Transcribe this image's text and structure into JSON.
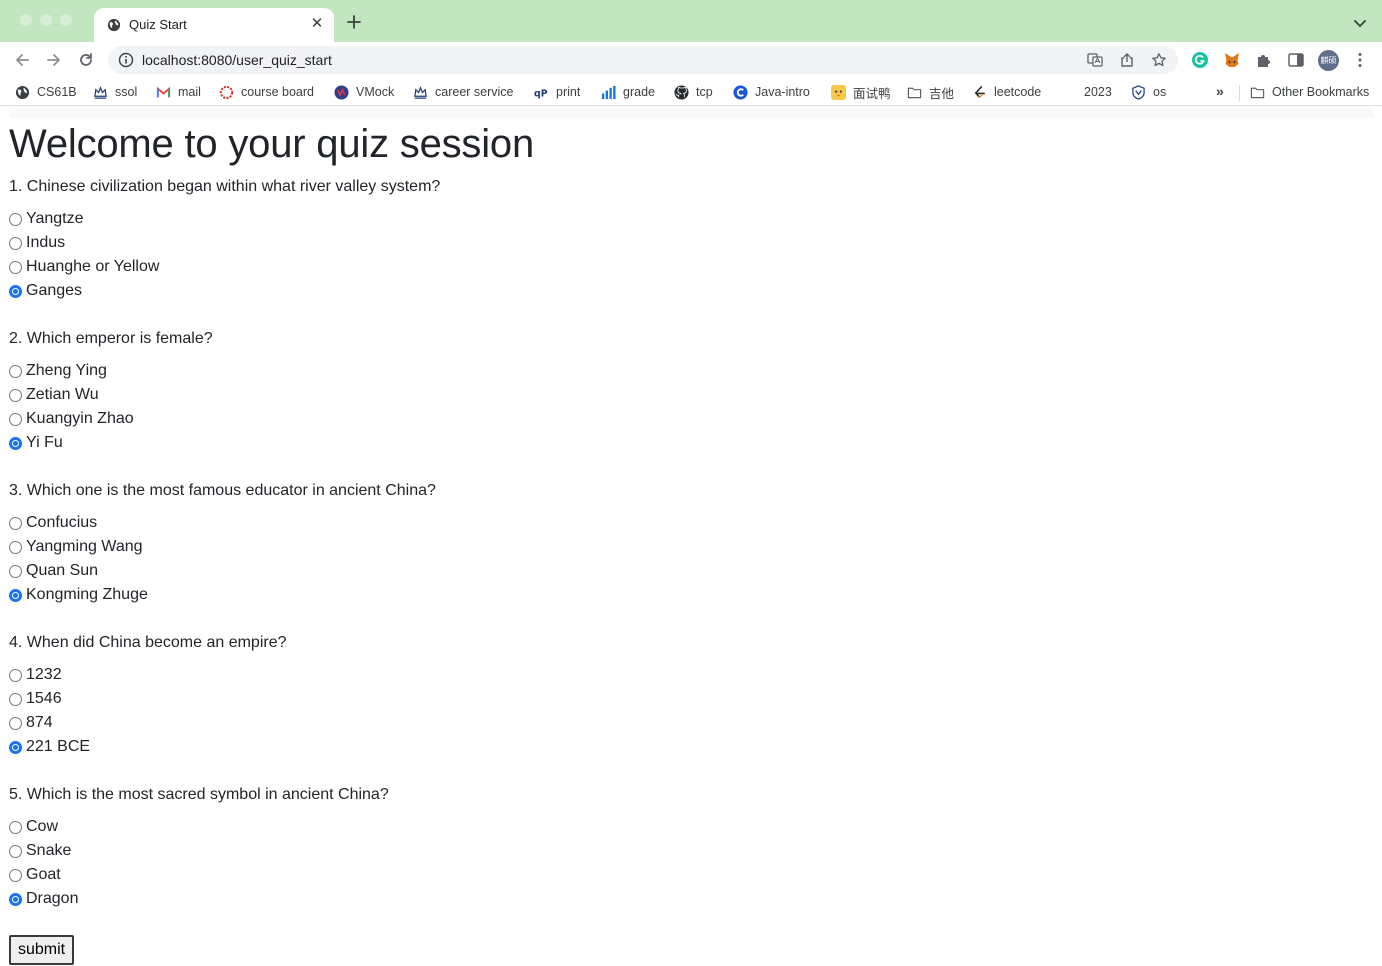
{
  "browser": {
    "tab_title": "Quiz Start",
    "url": "localhost:8080/user_quiz_start",
    "avatar_text": "麒硕",
    "bookmarks": [
      {
        "label": "CS61B",
        "icon": "globe-icon"
      },
      {
        "label": "ssol",
        "icon": "crown-icon"
      },
      {
        "label": "mail",
        "icon": "gmail-icon"
      },
      {
        "label": "course board",
        "icon": "ring-icon"
      },
      {
        "label": "VMock",
        "icon": "vmock-icon"
      },
      {
        "label": "career service",
        "icon": "crown-icon"
      },
      {
        "label": "print",
        "icon": "print-logo-icon"
      },
      {
        "label": "grade",
        "icon": "bar-chart-icon"
      },
      {
        "label": "tcp",
        "icon": "github-icon"
      },
      {
        "label": "Java-intro",
        "icon": "c-logo-icon"
      },
      {
        "label": "面试鸭",
        "icon": "duck-icon"
      },
      {
        "label": "吉他",
        "icon": "folder-icon"
      },
      {
        "label": "leetcode",
        "icon": "leetcode-icon"
      },
      {
        "label": "2023",
        "icon": "none"
      },
      {
        "label": "os",
        "icon": "shield-logo-icon"
      }
    ],
    "other_bookmarks": "Other Bookmarks",
    "more": "»"
  },
  "page": {
    "title": "Welcome to your quiz session",
    "questions": [
      {
        "text": "1. Chinese civilization began within what river valley system?",
        "options": [
          "Yangtze",
          "Indus",
          "Huanghe or Yellow",
          "Ganges"
        ],
        "selected": 3
      },
      {
        "text": "2. Which emperor is female?",
        "options": [
          "Zheng Ying",
          "Zetian Wu",
          "Kuangyin Zhao",
          "Yi Fu"
        ],
        "selected": 3
      },
      {
        "text": "3. Which one is the most famous educator in ancient China?",
        "options": [
          "Confucius",
          "Yangming Wang",
          "Quan Sun",
          "Kongming Zhuge"
        ],
        "selected": 3
      },
      {
        "text": "4. When did China become an empire?",
        "options": [
          "1232",
          "1546",
          "874",
          "221 BCE"
        ],
        "selected": 3
      },
      {
        "text": "5. Which is the most sacred symbol in ancient China?",
        "options": [
          "Cow",
          "Snake",
          "Goat",
          "Dragon"
        ],
        "selected": 3
      }
    ],
    "submit_label": "submit"
  },
  "colors": {
    "tabstrip": "#c2e6bf",
    "radio_checked": "#1a73e8"
  }
}
